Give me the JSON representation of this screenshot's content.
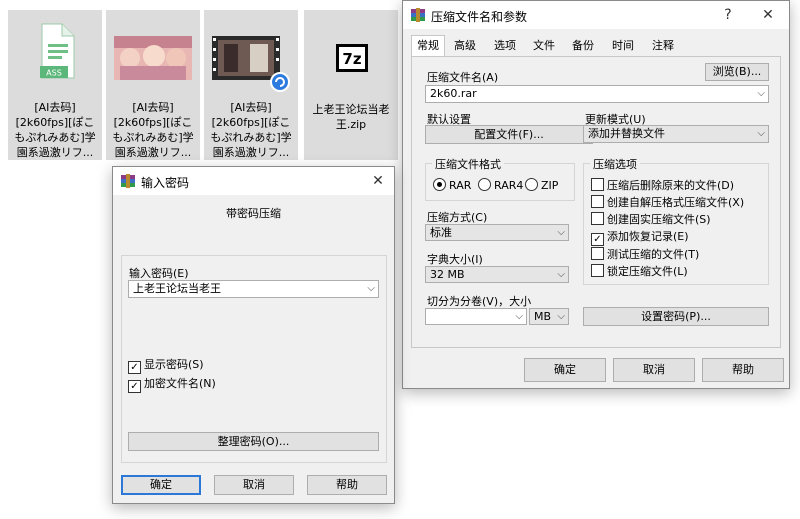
{
  "files": [
    {
      "caption": "[AI去码]\n[2k60fps][ぽこ\nもぷれみあむ]学\n園系過激リフ..."
    },
    {
      "caption": "[AI去码]\n[2k60fps][ぽこ\nもぷれみあむ]学\n園系過激リフ..."
    },
    {
      "caption": "[AI去码]\n[2k60fps][ぽこ\nもぷれみあむ]学\n園系過激リフ..."
    },
    {
      "caption": "上老王论坛当老\n王.zip"
    }
  ],
  "ass_badge": "ASS",
  "zip_badge": "7z",
  "password_dialog": {
    "title": "输入密码",
    "heading": "带密码压缩",
    "password_label": "输入密码(E)",
    "password_value": "上老王论坛当老王",
    "show_password": "显示密码(S)",
    "encrypt_names": "加密文件名(N)",
    "organize_button": "整理密码(O)...",
    "ok": "确定",
    "cancel": "取消",
    "help": "帮助"
  },
  "archive_dialog": {
    "title": "压缩文件名和参数",
    "help_glyph": "?",
    "tabs": [
      "常规",
      "高级",
      "选项",
      "文件",
      "备份",
      "时间",
      "注释"
    ],
    "archive_name_label": "压缩文件名(A)",
    "browse_button": "浏览(B)...",
    "archive_name_value": "2k60.rar",
    "default_settings_label": "默认设置",
    "profiles_button": "配置文件(F)...",
    "update_mode_label": "更新模式(U)",
    "update_mode_value": "添加并替换文件",
    "format_group": "压缩文件格式",
    "formats": [
      "RAR",
      "RAR4",
      "ZIP"
    ],
    "method_label": "压缩方式(C)",
    "method_value": "标准",
    "dict_label": "字典大小(I)",
    "dict_value": "32 MB",
    "split_label": "切分为分卷(V)，大小",
    "split_value": "",
    "split_unit": "MB",
    "options_group": "压缩选项",
    "options": [
      "压缩后删除原来的文件(D)",
      "创建自解压格式压缩文件(X)",
      "创建固实压缩文件(S)",
      "添加恢复记录(E)",
      "测试压缩的文件(T)",
      "锁定压缩文件(L)"
    ],
    "set_password_button": "设置密码(P)...",
    "ok": "确定",
    "cancel": "取消",
    "help": "帮助"
  }
}
